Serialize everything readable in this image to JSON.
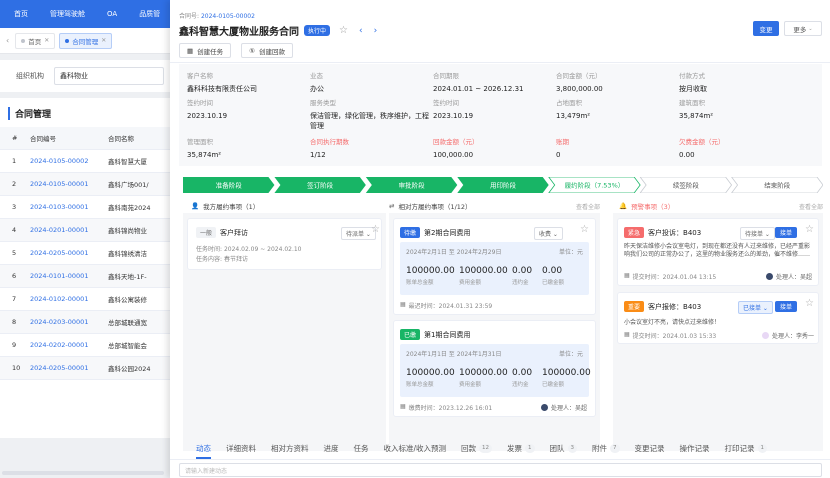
{
  "topnav": [
    "首页",
    "管理驾驶舱",
    "OA",
    "品质管"
  ],
  "tabs": [
    {
      "label": "首页",
      "active": false
    },
    {
      "label": "合同管理",
      "active": true
    }
  ],
  "filter": {
    "label": "组织机构",
    "value": "鑫科物业"
  },
  "list": {
    "title": "合同管理",
    "headers": [
      "#",
      "合同编号",
      "合同名称"
    ],
    "rows": [
      {
        "no": "1",
        "code": "2024-0105-00002",
        "name": "鑫科智慧大厦"
      },
      {
        "no": "2",
        "code": "2024-0105-00001",
        "name": "鑫科广场001/"
      },
      {
        "no": "3",
        "code": "2024-0103-00001",
        "name": "鑫科南苑2024"
      },
      {
        "no": "4",
        "code": "2024-0201-00001",
        "name": "鑫科锦尚物业"
      },
      {
        "no": "5",
        "code": "2024-0205-00001",
        "name": "鑫科锦绣清洁"
      },
      {
        "no": "6",
        "code": "2024-0101-00001",
        "name": "鑫科天地-1F-"
      },
      {
        "no": "7",
        "code": "2024-0102-00001",
        "name": "鑫科公寓装修"
      },
      {
        "no": "8",
        "code": "2024-0203-00001",
        "name": "总部城联通宽"
      },
      {
        "no": "9",
        "code": "2024-0202-00001",
        "name": "总部城智能会"
      },
      {
        "no": "10",
        "code": "2024-0205-00001",
        "name": "鑫科公园2024"
      }
    ]
  },
  "drawer": {
    "contract_no_label": "合同号:",
    "contract_no": "2024-0105-00002",
    "title": "鑫科智慧大厦物业服务合同",
    "status_badge": "执行中",
    "change_btn": "变更",
    "more_btn": "更多",
    "actions": [
      "创建任务",
      "创建回款"
    ],
    "info": [
      {
        "k": "客户名称",
        "v": "鑫科科技有限责任公司"
      },
      {
        "k": "业态",
        "v": "办公"
      },
      {
        "k": "合同期限",
        "v": "2024.01.01 ~ 2026.12.31"
      },
      {
        "k": "合同金额（元）",
        "v": "3,800,000.00"
      },
      {
        "k": "付款方式",
        "v": "按月收取"
      },
      {
        "k": "签约时间",
        "v": "2023.10.19"
      },
      {
        "k": "服务类型",
        "v": "保洁管理，绿化管理，秩序维护，工程管理"
      },
      {
        "k": "签约时间",
        "v": "2023.10.19"
      },
      {
        "k": "占地面积",
        "v": "13,479m²"
      },
      {
        "k": "建筑面积",
        "v": "35,874m²"
      },
      {
        "k": "管理面积",
        "v": "35,874m²"
      },
      {
        "k": "合同执行期数",
        "v": "1/12"
      },
      {
        "k": "回款金额（元）",
        "v": "100,000.00"
      },
      {
        "k": "账期",
        "v": "0"
      },
      {
        "k": "欠费金额（元）",
        "v": "0.00"
      }
    ],
    "stages": [
      {
        "label": "准备阶段",
        "state": "done"
      },
      {
        "label": "签订阶段",
        "state": "done"
      },
      {
        "label": "审批阶段",
        "state": "done"
      },
      {
        "label": "用印阶段",
        "state": "done"
      },
      {
        "label": "履约阶段（7.53%）",
        "state": "current"
      },
      {
        "label": "续签阶段",
        "state": "todo"
      },
      {
        "label": "结束阶段",
        "state": "todo"
      }
    ],
    "col1": {
      "title": "我方履约事项（1）",
      "card": {
        "tag": "一般",
        "title": "客户拜访",
        "status": "待派单",
        "period_label": "任务时间:",
        "period": "2024.02.09 ~ 2024.02.10",
        "content_label": "任务内容:",
        "content": "春节拜访"
      }
    },
    "col2": {
      "title": "相对方履约事项（1/12）",
      "more": "查看全部",
      "cards": [
        {
          "tag": "待缴",
          "title": "第2期合同费用",
          "status": "收费",
          "range": "2024年2月1日 至 2024年2月29日",
          "unit": "单位：元",
          "nums": [
            {
              "v": "100000.00",
              "l": "账单总金额"
            },
            {
              "v": "100000.00",
              "l": "费用金额"
            },
            {
              "v": "0.00",
              "l": "违约金"
            },
            {
              "v": "0.00",
              "l": "已缴金额"
            }
          ],
          "footer": "最迟时间：2024.01.31 23:59"
        },
        {
          "tag": "已缴",
          "title": "第1期合同费用",
          "range": "2024年1月1日 至 2024年1月31日",
          "unit": "单位：元",
          "nums": [
            {
              "v": "100000.00",
              "l": "账单总金额"
            },
            {
              "v": "100000.00",
              "l": "费用金额"
            },
            {
              "v": "0.00",
              "l": "违约金"
            },
            {
              "v": "100000.00",
              "l": "已缴金额"
            }
          ],
          "footer": "缴费时间：2023.12.26 16:01",
          "handler": "处理人：吴超"
        }
      ]
    },
    "col3": {
      "title": "预警事项（3）",
      "more": "查看全部",
      "cards": [
        {
          "tag": "紧急",
          "title": "客户投诉：B403",
          "status": "待接单",
          "btn": "接单",
          "body": "昨天保洁维修小会议室电灯，到现在都还没有人过来维修，已经严重影响我们公司的正常办公了，这里的物业服务还么的差劲，催不维修……",
          "footer": "提交时间：2024.01.04 13:15",
          "handler": "处理人：吴超"
        },
        {
          "tag": "重要",
          "title": "客户报修：B403",
          "status": "已接单",
          "btn": "接单",
          "body": "小会议室灯不亮，请快点过来维修！",
          "footer": "提交时间：2024.01.03 15:33",
          "handler": "处理人：李秀一"
        }
      ]
    },
    "bottom_tabs": [
      {
        "label": "动态",
        "count": null,
        "active": true
      },
      {
        "label": "详细资料",
        "count": null
      },
      {
        "label": "相对方资料",
        "count": null
      },
      {
        "label": "进度",
        "count": null
      },
      {
        "label": "任务",
        "count": null
      },
      {
        "label": "收入标准/收入预测",
        "count": null
      },
      {
        "label": "回款",
        "count": "12"
      },
      {
        "label": "发票",
        "count": "1"
      },
      {
        "label": "团队",
        "count": "3"
      },
      {
        "label": "附件",
        "count": "7"
      },
      {
        "label": "变更记录",
        "count": null
      },
      {
        "label": "操作记录",
        "count": null
      },
      {
        "label": "打印记录",
        "count": "1"
      }
    ],
    "new_dynamic_placeholder": "请输入新建动态"
  }
}
